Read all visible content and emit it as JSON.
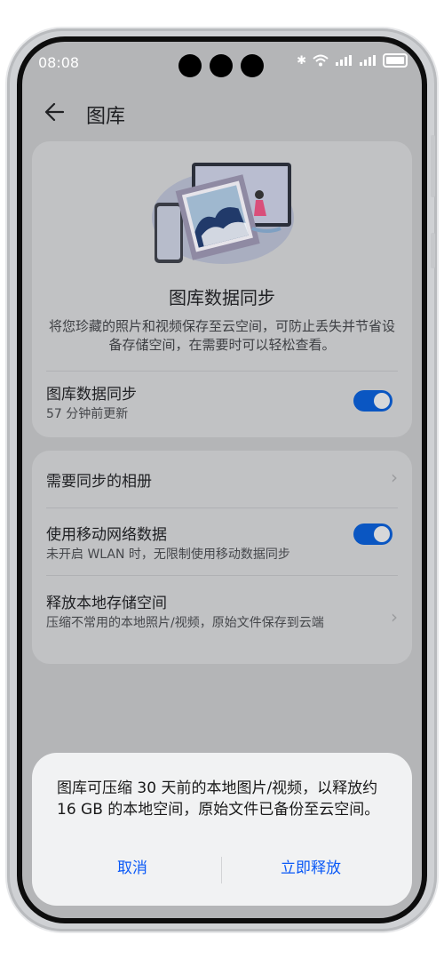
{
  "status": {
    "time": "08:08"
  },
  "header": {
    "title": "图库"
  },
  "sync_card": {
    "title": "图库数据同步",
    "description": "将您珍藏的照片和视频保存至云空间，可防止丢失并节省设备存储空间，在需要时可以轻松查看。",
    "row_title": "图库数据同步",
    "row_subtitle": "57 分钟前更新",
    "toggle_on": true
  },
  "settings": {
    "albums_label": "需要同步的相册",
    "mobile_data_label": "使用移动网络数据",
    "mobile_data_desc": "未开启 WLAN 时，无限制使用移动数据同步",
    "mobile_data_on": true,
    "free_space_label": "释放本地存储空间",
    "free_space_desc": "压缩不常用的本地照片/视频，原始文件保存到云端"
  },
  "dialog": {
    "message": "图库可压缩 30 天前的本地图片/视频，以释放约 16 GB 的本地空间，原始文件已备份至云空间。",
    "cancel_label": "取消",
    "confirm_label": "立即释放"
  },
  "colors": {
    "accent": "#0a59f7",
    "toggle": "#0a56c2"
  }
}
